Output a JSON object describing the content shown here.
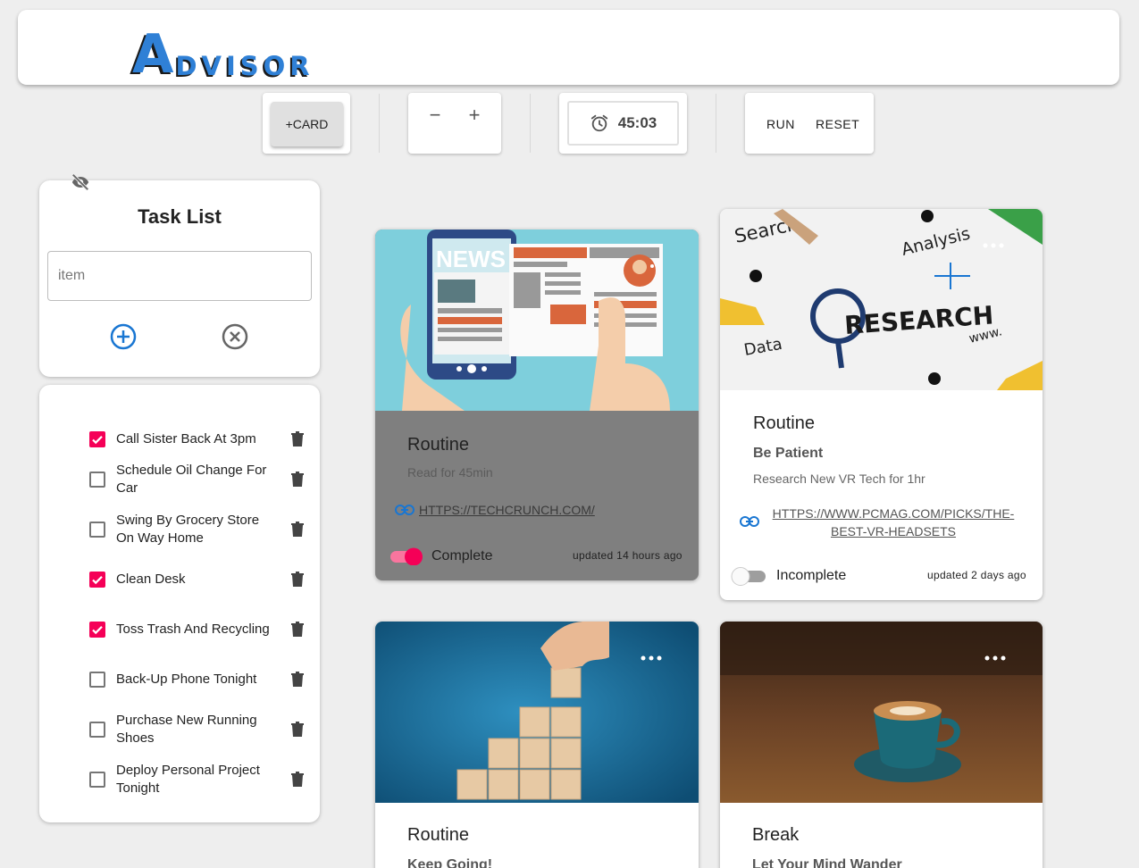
{
  "app": {
    "logo_big": "A",
    "logo_small": "DVISOR"
  },
  "toolbar": {
    "add_card_label": "+CARD",
    "decrement_label": "−",
    "increment_label": "+",
    "timer_value": "45:03",
    "run_label": "RUN",
    "reset_label": "RESET"
  },
  "task_list": {
    "title": "Task List",
    "input_placeholder": "item",
    "items": [
      {
        "label": "Call Sister Back At 3pm",
        "checked": true
      },
      {
        "label": "Schedule Oil Change For Car",
        "checked": false
      },
      {
        "label": "Swing By Grocery Store On Way Home",
        "checked": false
      },
      {
        "label": "Clean Desk",
        "checked": true
      },
      {
        "label": "Toss Trash And Recycling",
        "checked": true
      },
      {
        "label": "Back-Up Phone Tonight",
        "checked": false
      },
      {
        "label": "Purchase New Running Shoes",
        "checked": false
      },
      {
        "label": "Deploy Personal Project Tonight",
        "checked": false
      }
    ]
  },
  "cards": [
    {
      "image": "news-illustration",
      "title": "Routine",
      "subtitle": "",
      "description": "Read for 45min",
      "link": "HTTPS://TECHCRUNCH.COM/",
      "status": "Complete",
      "complete": true,
      "updated": "updated 14 hours ago"
    },
    {
      "image": "research-photo",
      "title": "Routine",
      "subtitle": "Be Patient",
      "description": "Research New VR Tech for 1hr",
      "link": "HTTPS://WWW.PCMAG.COM/PICKS/THE-BEST-VR-HEADSETS",
      "link_line1": "HTTPS://WWW.PCMAG.COM/PICKS/THE-",
      "link_line2": "BEST-VR-HEADSETS",
      "status": "Incomplete",
      "complete": false,
      "updated": "updated 2 days ago"
    },
    {
      "image": "wooden-blocks-photo",
      "title": "Routine",
      "subtitle": "Keep Going!"
    },
    {
      "image": "coffee-cup-photo",
      "title": "Break",
      "subtitle": "Let Your Mind Wander"
    }
  ],
  "colors": {
    "accent_pink": "#f50057",
    "link_blue": "#1976d2",
    "logo_blue": "#2f80d6"
  }
}
